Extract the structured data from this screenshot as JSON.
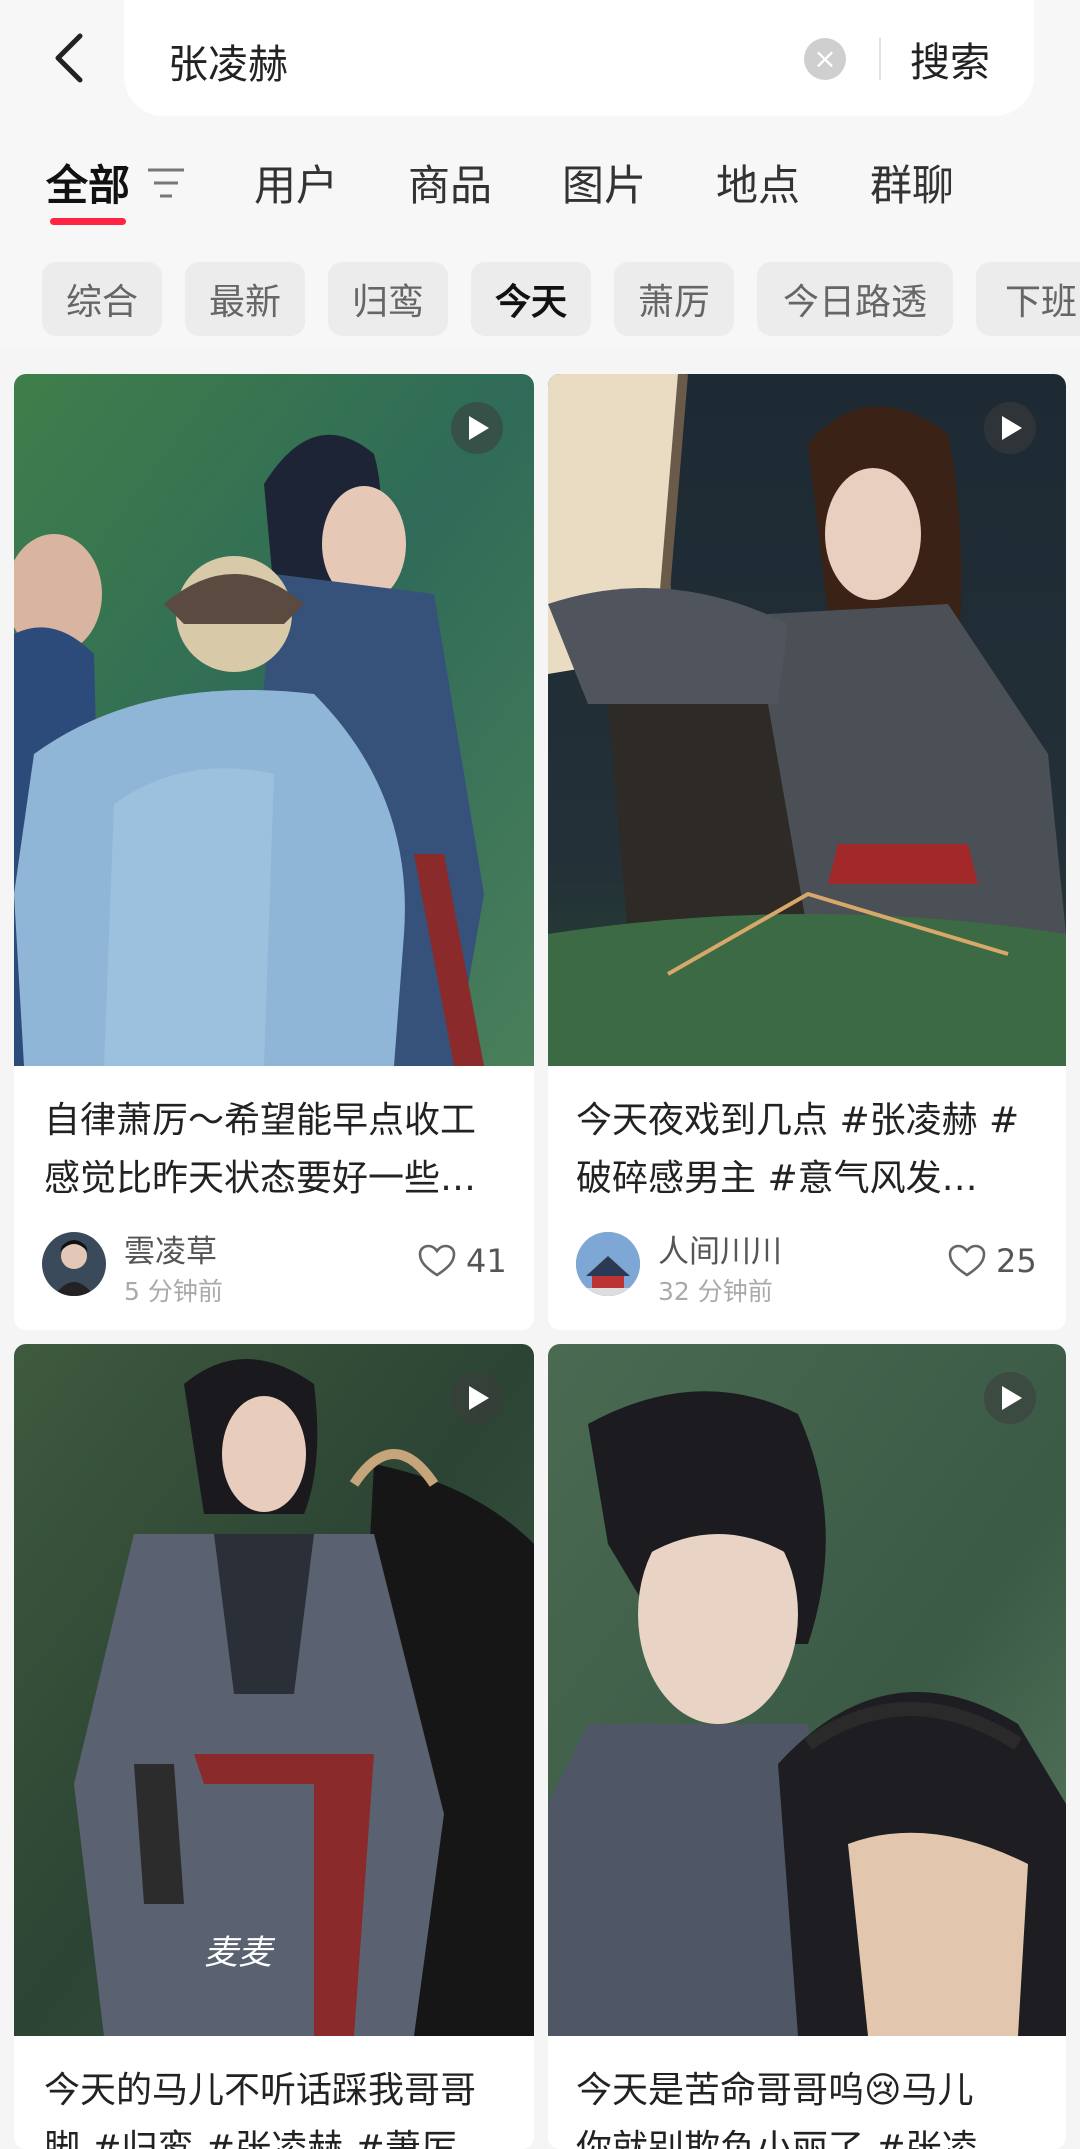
{
  "search": {
    "query": "张凌赫",
    "button": "搜索"
  },
  "tabs": [
    "全部",
    "用户",
    "商品",
    "图片",
    "地点",
    "群聊"
  ],
  "chips": [
    "综合",
    "最新",
    "归鸾",
    "今天",
    "萧厉",
    "今日路透",
    "下班"
  ],
  "accent": "#ff2442",
  "cards": [
    {
      "title_line1": "自律萧厉～希望能早点收工",
      "title_line2": "感觉比昨天状态要好一些…",
      "author": "雲凌草",
      "time": "5 分钟前",
      "likes": "41"
    },
    {
      "title_line1": "今天夜戏到几点 #张凌赫 #",
      "title_line2": "破碎感男主 #意气风发…",
      "author": "人间川川",
      "time": "32 分钟前",
      "likes": "25"
    },
    {
      "title_line1": "今天的马儿不听话踩我哥哥",
      "title_line2": "脚 #归鸾 #张凌赫 #萧厉"
    },
    {
      "title_line1": "今天是苦命哥哥呜😢马儿",
      "title_line2": "你就别欺负小丽了 #张凌"
    }
  ],
  "watermark": "麦麦"
}
